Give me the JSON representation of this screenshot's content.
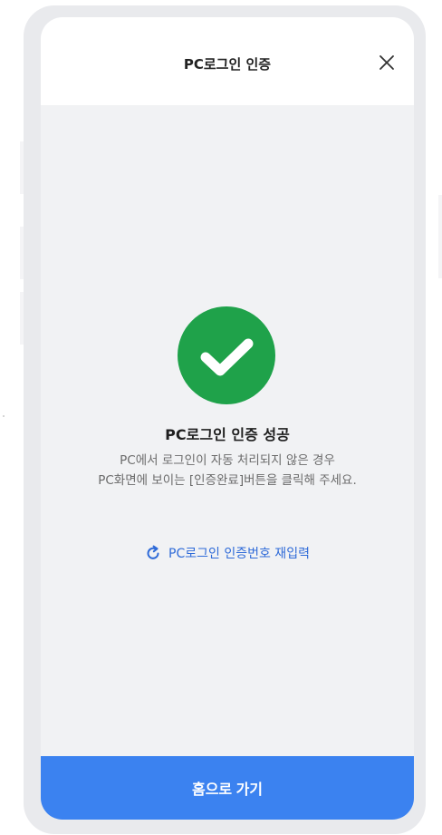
{
  "header": {
    "title": "PC로그인 인증",
    "close_icon": "close-icon"
  },
  "result": {
    "status_icon": "check-circle-icon",
    "title": "PC로그인 인증 성공",
    "description_line1": "PC에서 로그인이 자동 처리되지 않은 경우",
    "description_line2": "PC화면에 보이는 [인증완료]버튼을 클릭해 주세요.",
    "reenter_icon": "refresh-icon",
    "reenter_label": "PC로그인 인증번호 재입력"
  },
  "footer": {
    "home_label": "홈으로 가기"
  },
  "colors": {
    "success_green": "#1fa24a",
    "link_blue": "#2f6bd8",
    "primary_button": "#3b82f0"
  }
}
